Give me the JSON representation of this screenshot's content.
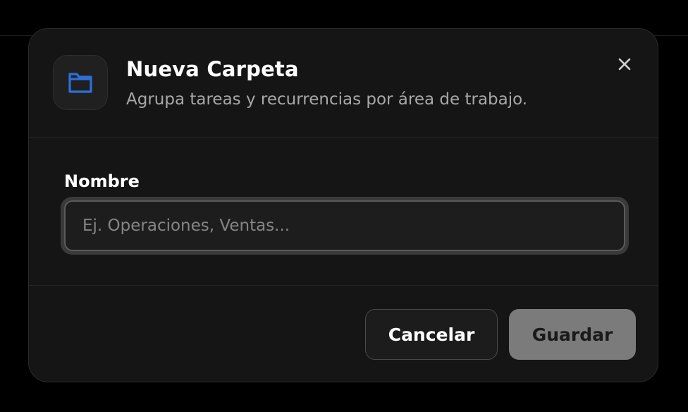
{
  "modal": {
    "title": "Nueva Carpeta",
    "subtitle": "Agrupa tareas y recurrencias por área de trabajo.",
    "icon": "folder-icon",
    "close_icon": "close-icon"
  },
  "form": {
    "name_label": "Nombre",
    "name_value": "",
    "name_placeholder": "Ej. Operaciones, Ventas..."
  },
  "actions": {
    "cancel_label": "Cancelar",
    "save_label": "Guardar"
  },
  "colors": {
    "background": "#000000",
    "modal_bg": "#151515",
    "accent_icon": "#2f6fd6",
    "save_button_bg": "#7b7b7b"
  }
}
